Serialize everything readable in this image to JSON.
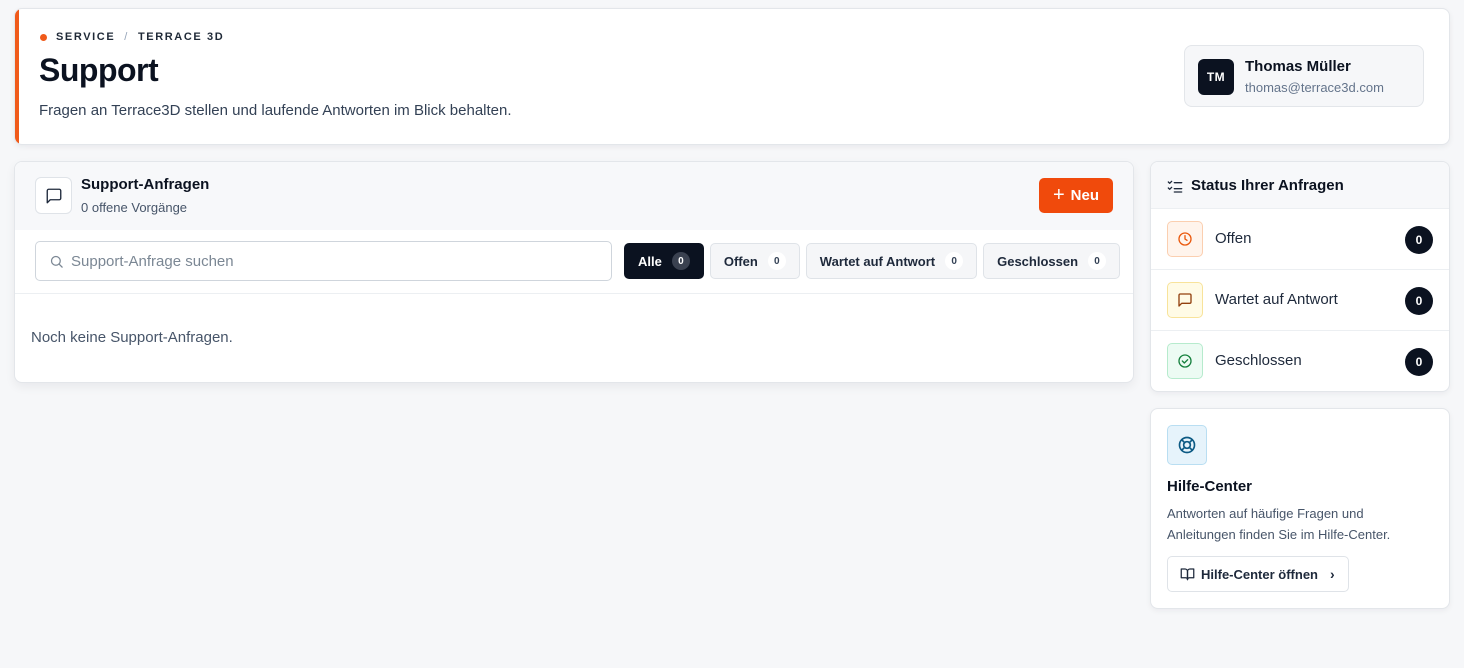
{
  "breadcrumb": {
    "section": "SERVICE",
    "separator": "/",
    "product": "TERRACE 3D"
  },
  "page": {
    "title": "Support",
    "subtitle": "Fragen an Terrace3D stellen und laufende Antworten im Blick behalten."
  },
  "user": {
    "initials": "TM",
    "name": "Thomas Müller",
    "email": "thomas@terrace3d.com"
  },
  "requests": {
    "title": "Support-Anfragen",
    "open_count_text": "0 offene Vorgänge",
    "new_button": "Neu",
    "search_placeholder": "Support-Anfrage suchen",
    "filters": [
      {
        "label": "Alle",
        "count": "0",
        "active": true
      },
      {
        "label": "Offen",
        "count": "0",
        "active": false
      },
      {
        "label": "Wartet auf Antwort",
        "count": "0",
        "active": false
      },
      {
        "label": "Geschlossen",
        "count": "0",
        "active": false
      }
    ],
    "empty_message": "Noch keine Support-Anfragen."
  },
  "status": {
    "title": "Status Ihrer Anfragen",
    "rows": [
      {
        "label": "Offen",
        "count": "0",
        "icon": "clock-icon"
      },
      {
        "label": "Wartet auf Antwort",
        "count": "0",
        "icon": "message-icon"
      },
      {
        "label": "Geschlossen",
        "count": "0",
        "icon": "check-circle-icon"
      }
    ]
  },
  "help": {
    "title": "Hilfe-Center",
    "text": "Antworten auf häufige Fragen und Anleitungen finden Sie im Hilfe-Center.",
    "button": "Hilfe-Center öffnen"
  },
  "colors": {
    "accent": "#f05a1a",
    "primary_button": "#f04a0c",
    "dark": "#0b1220"
  }
}
